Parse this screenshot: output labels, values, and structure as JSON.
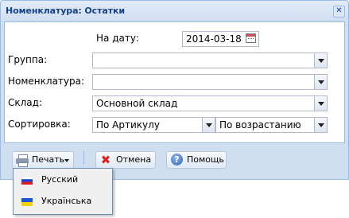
{
  "window": {
    "title": "Номенклатура: Остатки"
  },
  "form": {
    "date": {
      "label": "На дату:",
      "value": "2014-03-18"
    },
    "group": {
      "label": "Группа:",
      "value": ""
    },
    "nomenclature": {
      "label": "Номенклатура:",
      "value": ""
    },
    "warehouse": {
      "label": "Склад:",
      "value": "Основной склад"
    },
    "sort": {
      "label": "Сортировка:",
      "field_value": "По Артикулу",
      "order_value": "По возрастанию"
    }
  },
  "toolbar": {
    "print_label": "Печать",
    "cancel_label": "Отмена",
    "help_label": "Помощь"
  },
  "print_menu": {
    "items": [
      {
        "label": "Русский",
        "flag_colors": [
          "#ffffff",
          "#1c3fd1",
          "#e01a1a"
        ]
      },
      {
        "label": "Українська",
        "flag_colors": [
          "#1a56d6",
          "#f5d000"
        ]
      }
    ]
  },
  "icons": {
    "close": "close-icon",
    "calendar": "calendar-icon",
    "printer": "printer-icon",
    "cancel": "cancel-icon",
    "help": "help-icon"
  },
  "colors": {
    "title_text": "#15428b",
    "window_border": "#99bbe8",
    "window_bg": "#cfdff0"
  }
}
